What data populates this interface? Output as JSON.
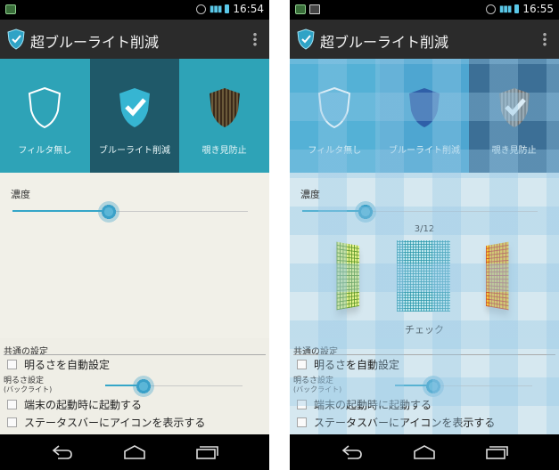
{
  "left": {
    "status": {
      "time": "16:54"
    },
    "app": {
      "title": "超ブルーライト削減"
    },
    "modes": [
      {
        "label": "フィルタ無し"
      },
      {
        "label": "ブルーライト削減"
      },
      {
        "label": "覗き見防止"
      }
    ],
    "density": {
      "label": "濃度",
      "value": 0.41
    },
    "settings": {
      "header": "共通の設定",
      "auto_brightness": "明るさを自動設定",
      "brightness_label": "明るさ設定",
      "brightness_sub": "(バックライト)",
      "brightness_value": 0.28,
      "start_on_boot": "端末の起動時に起動する",
      "statusbar_icon": "ステータスバーにアイコンを表示する"
    }
  },
  "right": {
    "status": {
      "time": "16:55"
    },
    "app": {
      "title": "超ブルーライト削減"
    },
    "modes": [
      {
        "label": "フィルタ無し"
      },
      {
        "label": "ブルーライト削減"
      },
      {
        "label": "覗き見防止"
      }
    ],
    "density": {
      "label": "濃度",
      "value": 0.27
    },
    "pattern": {
      "page": "3/12",
      "name": "チェック"
    },
    "settings": {
      "header": "共通の設定",
      "auto_brightness": "明るさを自動設定",
      "brightness_label": "明るさ設定",
      "brightness_sub": "(バックライト)",
      "brightness_value": 0.28,
      "start_on_boot": "端末の起動時に起動する",
      "statusbar_icon": "ステータスバーにアイコンを表示する"
    }
  },
  "colors": {
    "accent": "#35a6c8",
    "teal": "#2ea3b7",
    "dark_teal": "#1f5969"
  }
}
